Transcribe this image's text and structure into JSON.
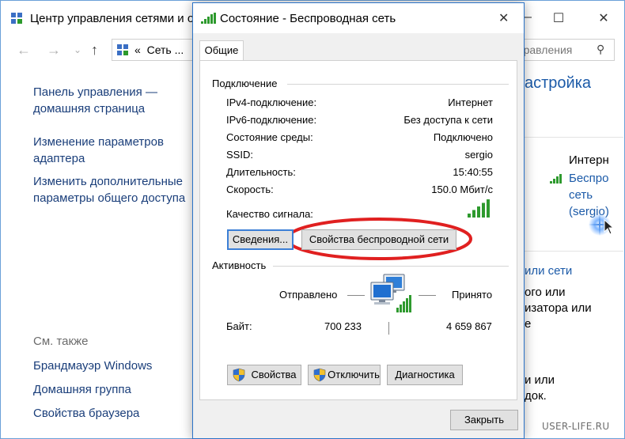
{
  "background_window": {
    "title": "Центр управления сетями и о",
    "address_prefix": "«",
    "address_text": "Сеть ...",
    "search_placeholder": "правления",
    "left_links": {
      "home": "Панель управления —\nдомашняя страница",
      "adapter": "Изменение параметров\nадаптера",
      "sharing": "Изменить дополнительные\nпараметры общего доступа"
    },
    "see_also": {
      "heading": "См. также",
      "firewall": "Брандмауэр Windows",
      "homegroup": "Домашняя группа",
      "browser": "Свойства браузера"
    },
    "right_title": "астройка",
    "internet": "Интерн",
    "network_link_lines": [
      "Беспро",
      "сеть",
      "(sergio)"
    ],
    "fragments": {
      "link": "или сети",
      "line1": "ого или",
      "line2": "изатора или",
      "line3": "е",
      "line4": "и или",
      "line5": "док."
    }
  },
  "watermark": "USER-LIFE.RU",
  "dialog": {
    "title": "Состояние - Беспроводная сеть",
    "tab": "Общие",
    "connection": {
      "heading": "Подключение",
      "rows": [
        {
          "label": "IPv4-подключение:",
          "value": "Интернет"
        },
        {
          "label": "IPv6-подключение:",
          "value": "Без доступа к сети"
        },
        {
          "label": "Состояние среды:",
          "value": "Подключено"
        },
        {
          "label": "SSID:",
          "value": "sergio"
        },
        {
          "label": "Длительность:",
          "value": "15:40:55"
        },
        {
          "label": "Скорость:",
          "value": "150.0 Мбит/с"
        }
      ],
      "signal_label": "Качество сигнала:",
      "signal_bars": 5,
      "signal_max": 5
    },
    "buttons": {
      "details": "Сведения...",
      "wireless_properties": "Свойства беспроводной сети",
      "properties": "Свойства",
      "disable": "Отключить",
      "diagnostics": "Диагностика",
      "close": "Закрыть"
    },
    "activity": {
      "heading": "Активность",
      "sent_label": "Отправлено",
      "received_label": "Принято",
      "bytes_label": "Байт:",
      "bytes_sent": "700 233",
      "bytes_received": "4 659 867"
    }
  },
  "colors": {
    "accent": "#2b73c8",
    "link": "#1b5aa8",
    "highlight_ellipse": "#e02020",
    "signal_green": "#2e9a2e"
  }
}
